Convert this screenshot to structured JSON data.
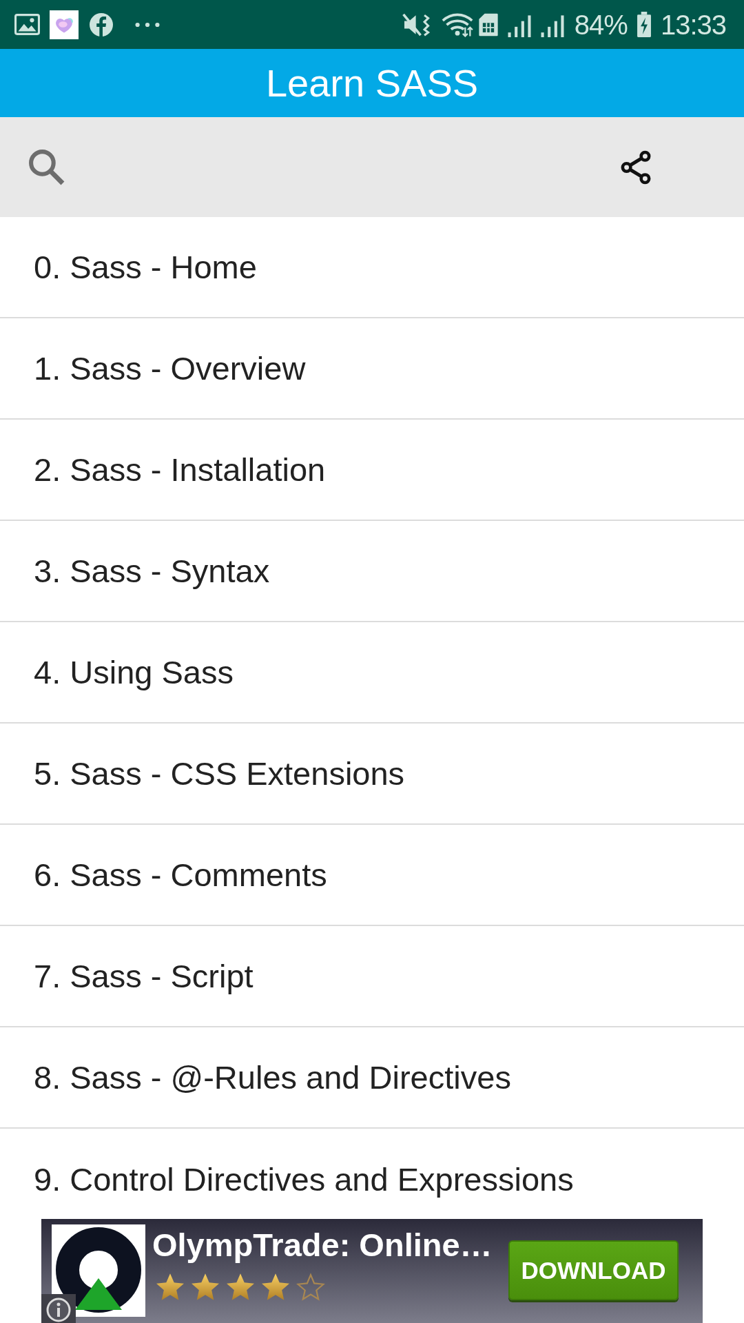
{
  "status_bar": {
    "battery": "84%",
    "time": "13:33"
  },
  "app_bar": {
    "title": "Learn SASS"
  },
  "chapters": [
    "0. Sass - Home",
    "1. Sass - Overview",
    "2. Sass - Installation",
    "3. Sass - Syntax",
    "4. Using Sass",
    "5. Sass - CSS Extensions",
    "6. Sass - Comments",
    "7. Sass - Script",
    "8. Sass - @-Rules and Directives",
    "9. Control Directives and Expressions"
  ],
  "ad": {
    "title": "OlympTrade: Online…",
    "stars": 4,
    "button": "DOWNLOAD"
  }
}
